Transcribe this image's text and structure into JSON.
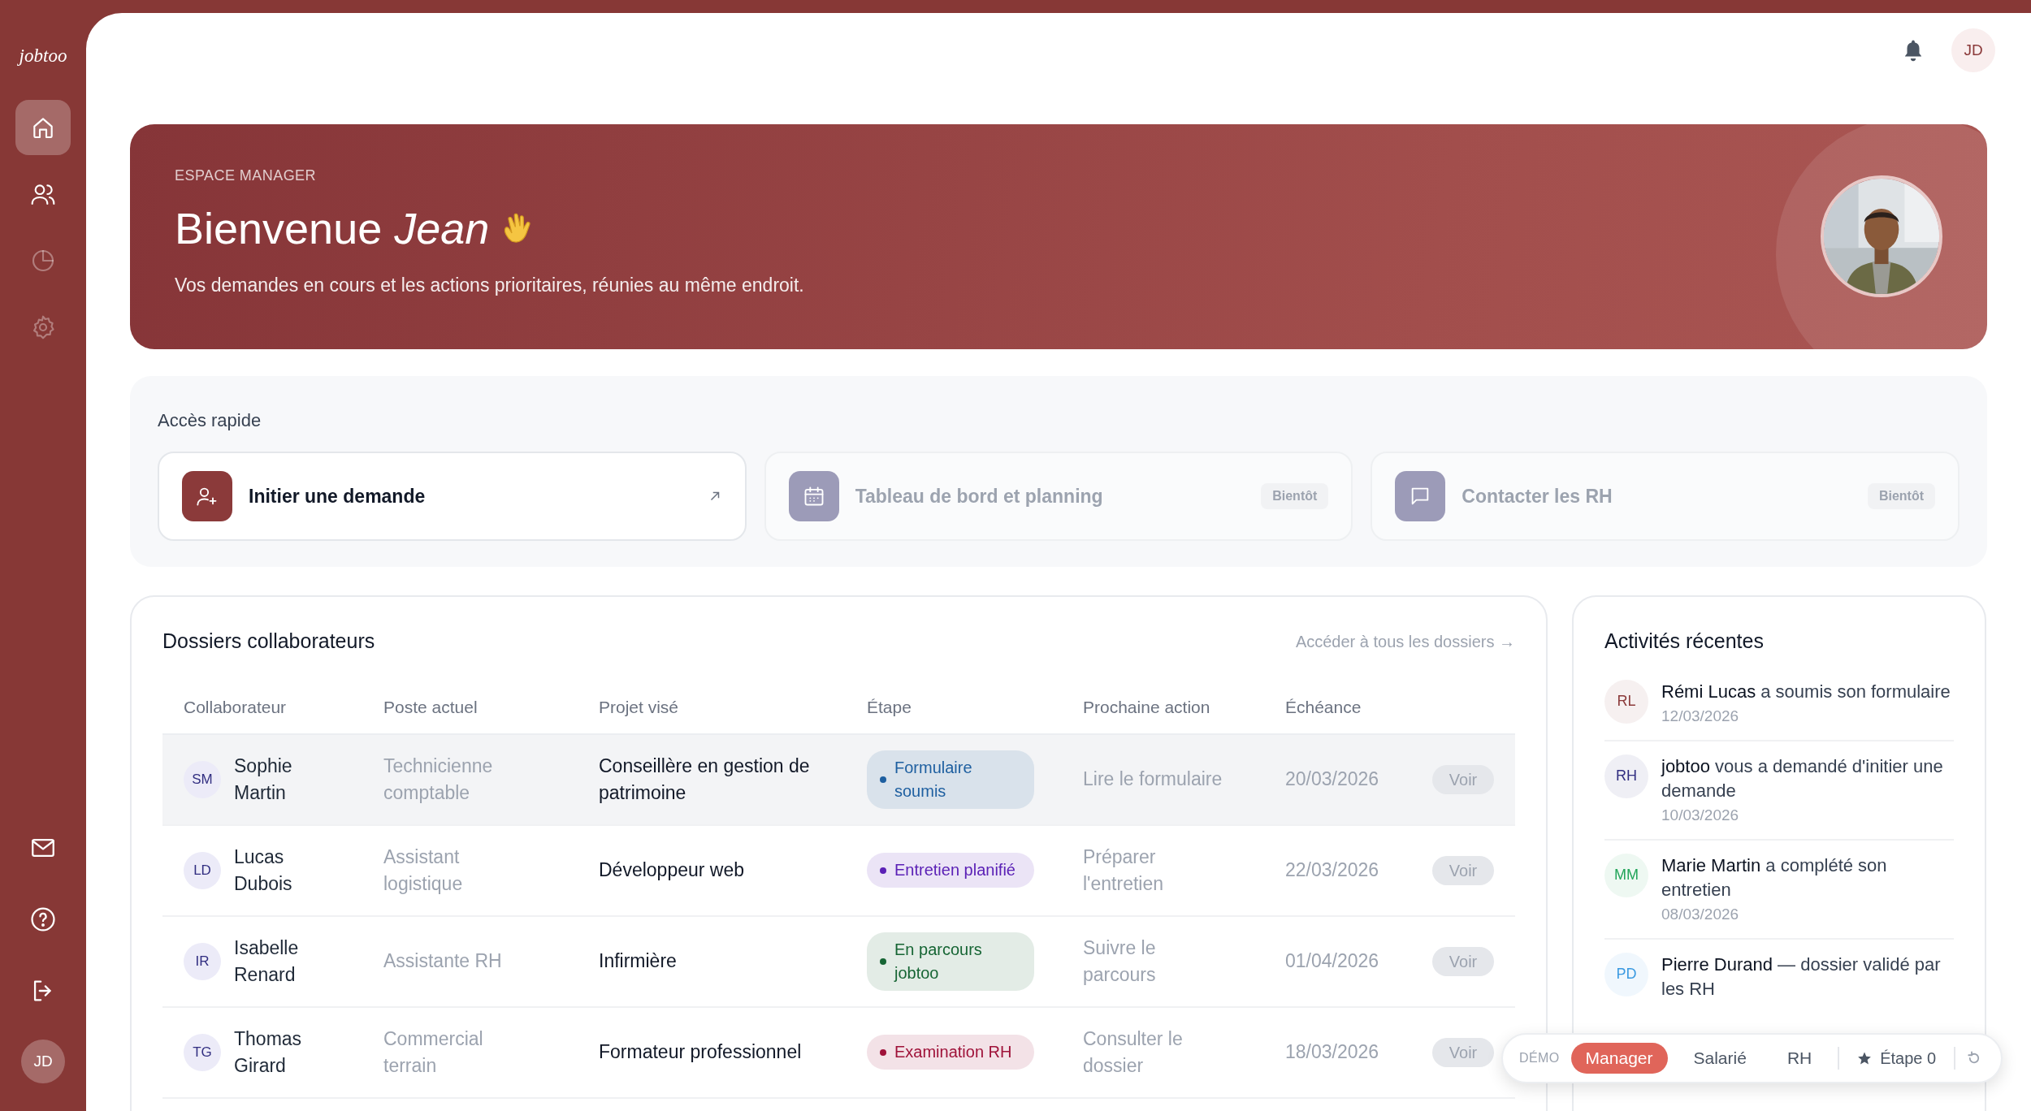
{
  "sidebar": {
    "logo": "jobtoo",
    "items": [
      {
        "selected": true,
        "disabled": false
      },
      {
        "selected": false,
        "disabled": false
      },
      {
        "selected": false,
        "disabled": true
      },
      {
        "selected": false,
        "disabled": true
      }
    ],
    "user_initials": "JD"
  },
  "header": {
    "user_initials": "JD"
  },
  "banner": {
    "eyebrow": "ESPACE MANAGER",
    "title": "Bienvenue *Jean*",
    "subtitle": "Vos demandes en cours et les actions prioritaires, réunies au même endroit."
  },
  "quick_access": {
    "title": "Accès rapide",
    "cards": [
      {
        "label": "Initier une demande",
        "disabled": false
      },
      {
        "label": "Tableau de bord et planning",
        "disabled": true,
        "badge": "Bientôt"
      },
      {
        "label": "Contacter les RH",
        "disabled": true,
        "badge": "Bientôt"
      }
    ]
  },
  "dossiers": {
    "title": "Dossiers collaborateurs",
    "link": "Accéder à tous les dossiers →",
    "columns": [
      "Collaborateur",
      "Poste actuel",
      "Projet visé",
      "Étape",
      "Prochaine action",
      "Échéance"
    ],
    "rows": [
      {
        "initials": "SM",
        "name": "Sophie Martin",
        "poste": "Technicienne comptable",
        "projet": "Conseillère en gestion de patrimoine",
        "etape": {
          "label": "Formulaire soumis",
          "color": "#1e5fa0"
        },
        "action": "Lire le formulaire",
        "echeance": "20/03/2026",
        "button": "Voir",
        "selected": true
      },
      {
        "initials": "LD",
        "name": "Lucas Dubois",
        "poste": "Assistant logistique",
        "projet": "Développeur web",
        "etape": {
          "label": "Entretien planifié",
          "color": "#5b21b6"
        },
        "action": "Préparer l'entretien",
        "echeance": "22/03/2026",
        "button": "Voir",
        "selected": false
      },
      {
        "initials": "IR",
        "name": "Isabelle Renard",
        "poste": "Assistante RH",
        "projet": "Infirmière",
        "etape": {
          "label": "En parcours jobtoo",
          "color": "#166534"
        },
        "action": "Suivre le parcours",
        "echeance": "01/04/2026",
        "button": "Voir",
        "selected": false
      },
      {
        "initials": "TG",
        "name": "Thomas Girard",
        "poste": "Commercial terrain",
        "projet": "Formateur professionnel",
        "etape": {
          "label": "Examination RH",
          "color": "#9f1239"
        },
        "action": "Consulter le dossier",
        "echeance": "18/03/2026",
        "button": "Voir",
        "selected": false
      }
    ]
  },
  "activities": {
    "title": "Activités récentes",
    "items": [
      {
        "initials": "RL",
        "color": "#8b3a3a",
        "text": "**Rémi Lucas** a soumis son formulaire",
        "date": "12/03/2026"
      },
      {
        "initials": "RH",
        "color": "#312e81",
        "text": "**jobtoo** vous a demandé d'initier une demande",
        "date": "10/03/2026"
      },
      {
        "initials": "MM",
        "color": "#22a55a",
        "text": "**Marie Martin** a complété son entretien",
        "date": "08/03/2026"
      },
      {
        "initials": "PD",
        "color": "#3b9ae1",
        "text": "**Pierre Durand** — dossier validé par les RH"
      }
    ]
  },
  "demo_bar": {
    "label": "DÉMO",
    "roles": [
      {
        "label": "Manager",
        "selected": true
      },
      {
        "label": "Salarié",
        "selected": false
      },
      {
        "label": "RH",
        "selected": false
      }
    ],
    "step": "Étape 0"
  }
}
